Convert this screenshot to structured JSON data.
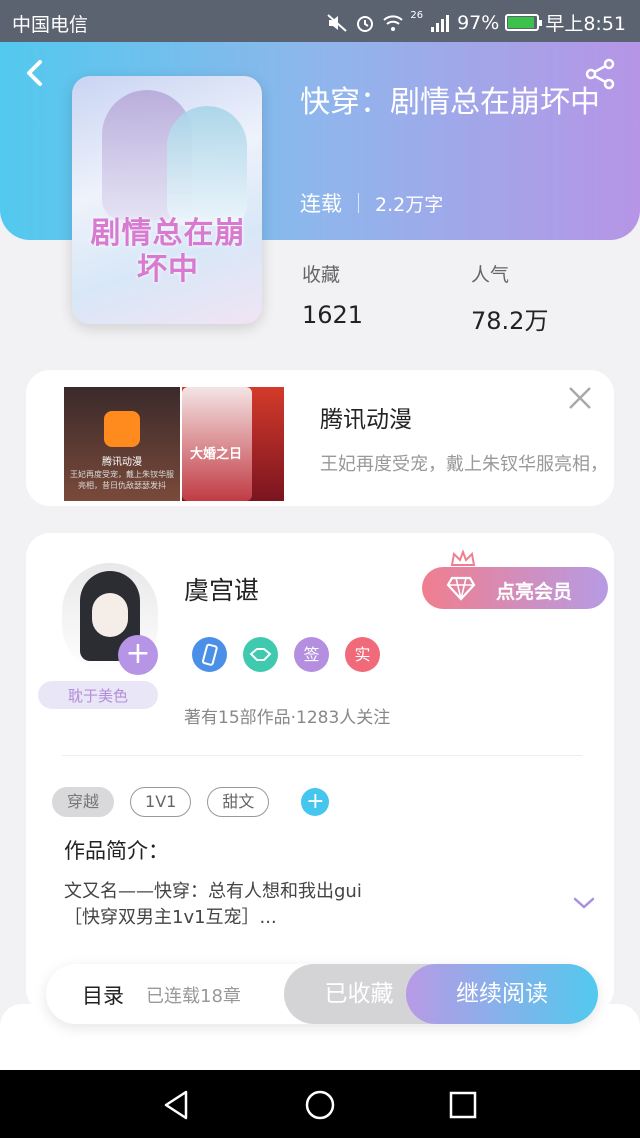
{
  "status_bar": {
    "carrier": "中国电信",
    "network": "26",
    "battery": "97%",
    "time": "早上8:51"
  },
  "book": {
    "title": "快穿：剧情总在崩坏中",
    "cover_title": "剧情总在崩坏中",
    "status": "连载",
    "word_count": "2.2万字",
    "stats": [
      {
        "label": "收藏",
        "value": "1621"
      },
      {
        "label": "人气",
        "value": "78.2万"
      }
    ]
  },
  "ad": {
    "title": "腾讯动漫",
    "description": "王妃再度受宠，戴上朱钗华服亮相，昔日仇敌瑟瑟发抖",
    "image1_title": "腾讯动漫",
    "image1_text": "王妃再度受宠，戴上朱钗华服亮相，昔日仇敌瑟瑟发抖",
    "image2_title": "大婚之日"
  },
  "author": {
    "name": "虞宫谌",
    "vip_label": "点亮会员",
    "badges": [
      {
        "icon": "phone-badge-icon",
        "color": "#4a8fe8",
        "text": ""
      },
      {
        "icon": "handshake-badge-icon",
        "color": "#3fcab0",
        "text": ""
      },
      {
        "icon": "sign-badge",
        "color": "#b48fe0",
        "text": "签"
      },
      {
        "icon": "real-badge",
        "color": "#f06a7a",
        "text": "实"
      }
    ],
    "fan_tag": "耽于美色",
    "works_summary": "著有15部作品·1283人关注"
  },
  "tags": [
    "穿越",
    "1V1",
    "甜文"
  ],
  "intro": {
    "label": "作品简介：",
    "text_line1": "文又名——快穿：总有人想和我出gui",
    "text_line2": "［快穿双男主1v1互宠］..."
  },
  "action_bar": {
    "toc": "目录",
    "chapters": "已连载18章",
    "collected": "已收藏",
    "continue": "继续阅读"
  },
  "colors": {
    "accent_blue": "#52c9ee",
    "accent_purple": "#b695e6"
  }
}
